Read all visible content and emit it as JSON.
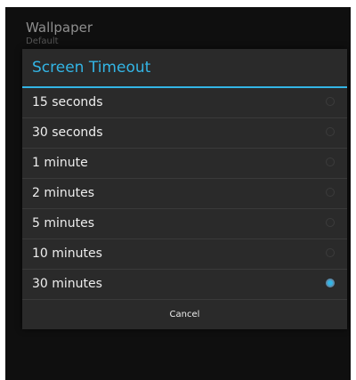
{
  "background": {
    "item_title": "Wallpaper",
    "item_subtitle": "Default"
  },
  "dialog": {
    "title": "Screen Timeout",
    "options": [
      {
        "label": "15 seconds",
        "selected": false
      },
      {
        "label": "30 seconds",
        "selected": false
      },
      {
        "label": "1 minute",
        "selected": false
      },
      {
        "label": "2 minutes",
        "selected": false
      },
      {
        "label": "5 minutes",
        "selected": false
      },
      {
        "label": "10 minutes",
        "selected": false
      },
      {
        "label": "30 minutes",
        "selected": true
      }
    ],
    "cancel_label": "Cancel"
  },
  "colors": {
    "accent": "#33b5e5",
    "dialog_bg": "#2a2a2a",
    "screen_bg": "#0c0c0c"
  }
}
